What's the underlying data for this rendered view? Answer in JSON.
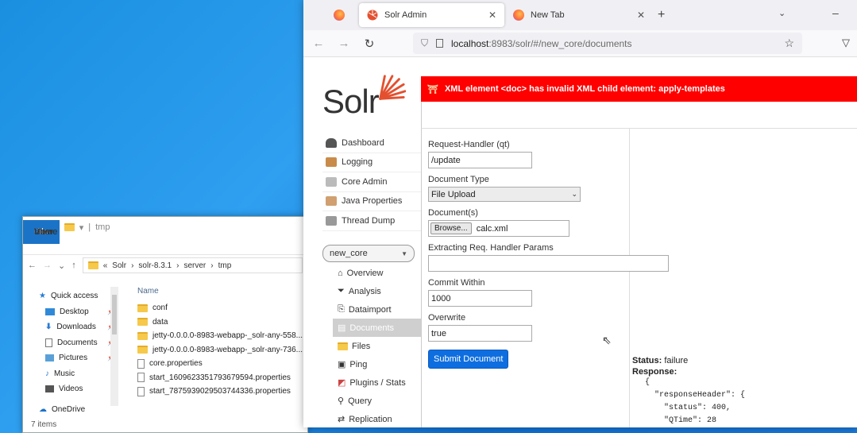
{
  "explorer": {
    "title": "tmp",
    "ribbon_tabs": [
      "File",
      "Home",
      "Share",
      "View"
    ],
    "path": [
      "«",
      "Solr",
      "›",
      "solr-8.3.1",
      "›",
      "server",
      "›",
      "tmp"
    ],
    "nav_items": [
      {
        "label": "Quick access",
        "icon": "star-icon",
        "pinned": false
      },
      {
        "label": "Desktop",
        "icon": "desktop-icon",
        "pinned": true
      },
      {
        "label": "Downloads",
        "icon": "download-icon",
        "pinned": true
      },
      {
        "label": "Documents",
        "icon": "documents-icon",
        "pinned": true
      },
      {
        "label": "Pictures",
        "icon": "pictures-icon",
        "pinned": true
      },
      {
        "label": "Music",
        "icon": "music-icon",
        "pinned": false
      },
      {
        "label": "Videos",
        "icon": "videos-icon",
        "pinned": false
      },
      {
        "label": "OneDrive",
        "icon": "cloud-icon",
        "pinned": false
      }
    ],
    "column_header": "Name",
    "files": [
      {
        "name": "conf",
        "type": "folder"
      },
      {
        "name": "data",
        "type": "folder"
      },
      {
        "name": "jetty-0.0.0.0-8983-webapp-_solr-any-558...",
        "type": "folder"
      },
      {
        "name": "jetty-0.0.0.0-8983-webapp-_solr-any-736...",
        "type": "folder"
      },
      {
        "name": "core.properties",
        "type": "file"
      },
      {
        "name": "start_1609623351793679594.properties",
        "type": "file"
      },
      {
        "name": "start_7875939029503744336.properties",
        "type": "file"
      }
    ],
    "status": "7 items"
  },
  "browser": {
    "tabs": [
      {
        "label": "Solr Admin",
        "active": true
      },
      {
        "label": "New Tab",
        "active": false
      }
    ],
    "url_host": "localhost",
    "url_rest": ":8983/solr/#/new_core/documents"
  },
  "solr": {
    "logo_text": "Solr",
    "error_message": "XML element <doc> has invalid XML child element: apply-templates",
    "menu": [
      "Dashboard",
      "Logging",
      "Core Admin",
      "Java Properties",
      "Thread Dump"
    ],
    "core_selected": "new_core",
    "core_menu": [
      "Overview",
      "Analysis",
      "Dataimport",
      "Documents",
      "Files",
      "Ping",
      "Plugins / Stats",
      "Query",
      "Replication"
    ],
    "form": {
      "request_handler_label": "Request-Handler (qt)",
      "request_handler_value": "/update",
      "document_type_label": "Document Type",
      "document_type_value": "File Upload",
      "documents_label": "Document(s)",
      "browse_label": "Browse...",
      "file_name": "calc.xml",
      "extract_label": "Extracting Req. Handler Params",
      "extract_value": "",
      "commit_label": "Commit Within",
      "commit_value": "1000",
      "overwrite_label": "Overwrite",
      "overwrite_value": "true",
      "submit_label": "Submit Document"
    },
    "result": {
      "status_label": "Status:",
      "status_value": "failure",
      "response_label": "Response:",
      "lines": [
        "{",
        "  \"responseHeader\": {",
        "    \"status\": 400,",
        "    \"QTime\": 28"
      ]
    }
  }
}
